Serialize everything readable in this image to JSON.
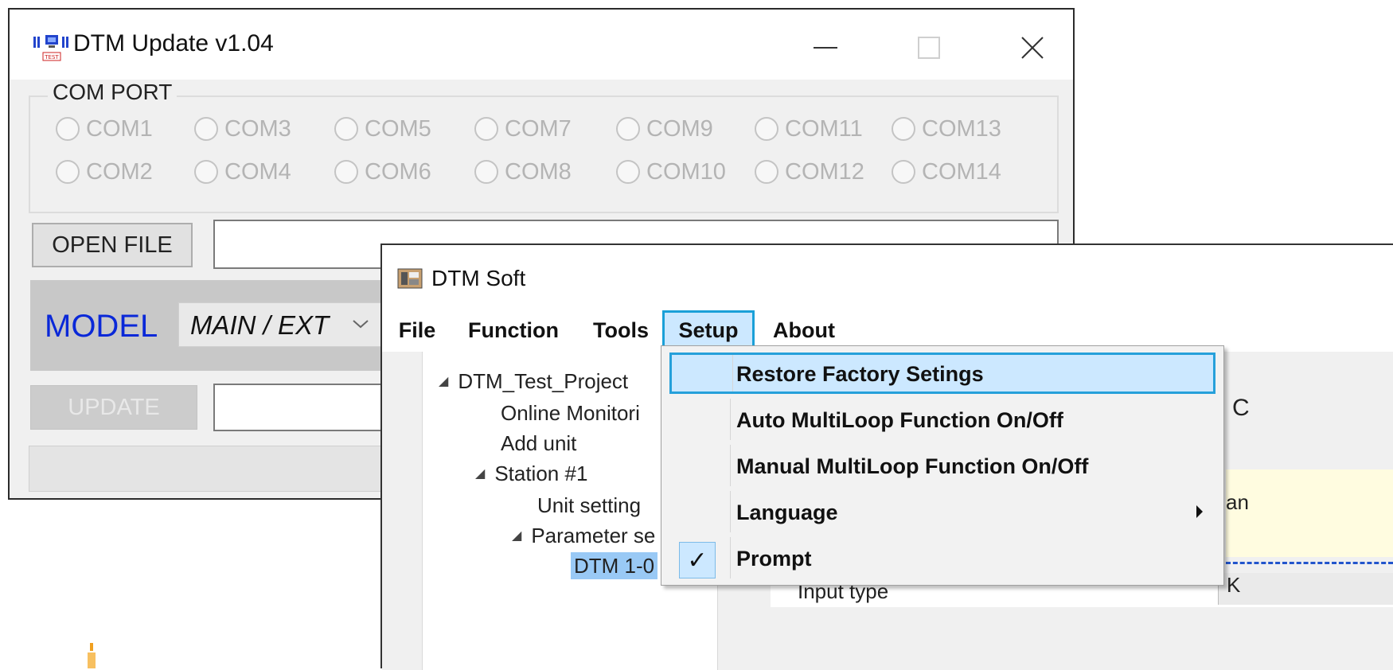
{
  "update_window": {
    "title": "DTM Update v1.04",
    "comport": {
      "legend": "COM PORT",
      "row1": [
        "COM1",
        "COM3",
        "COM5",
        "COM7",
        "COM9",
        "COM11",
        "COM13"
      ],
      "row2": [
        "COM2",
        "COM4",
        "COM6",
        "COM8",
        "COM10",
        "COM12",
        "COM14"
      ]
    },
    "open_file_label": "OPEN FILE",
    "file_path_value": "",
    "model_label": "MODEL",
    "model_value": "MAIN / EXT",
    "update_label": "UPDATE",
    "update_field_value": ""
  },
  "soft_window": {
    "title": "DTM Soft",
    "menu": [
      "File",
      "Function",
      "Tools",
      "Setup",
      "About"
    ],
    "active_menu": "Setup",
    "tree": {
      "project": "DTM_Test_Project",
      "online": "Online Monitori",
      "add_unit": "Add unit",
      "station": "Station #1",
      "unit_setting": "Unit setting",
      "param": "Parameter se",
      "dtm": "DTM 1-0"
    },
    "right_panel": {
      "partial_c": "C",
      "partial_an": "an",
      "input_type": "Input type",
      "partial_k": "K"
    }
  },
  "setup_menu": {
    "items": [
      {
        "label": "Restore Factory Setings",
        "highlighted": true
      },
      {
        "label": "Auto MultiLoop Function  On/Off"
      },
      {
        "label": "Manual MultiLoop Function  On/Off"
      },
      {
        "label": "Language",
        "submenu": true
      },
      {
        "label": "Prompt",
        "checked": true
      }
    ],
    "check_glyph": "✓"
  },
  "colors": {
    "model_label": "#0a28d8",
    "menu_highlight": "#cce8ff",
    "menu_highlight_border": "#1aa0d8",
    "tree_selection": "#99c9f5"
  }
}
